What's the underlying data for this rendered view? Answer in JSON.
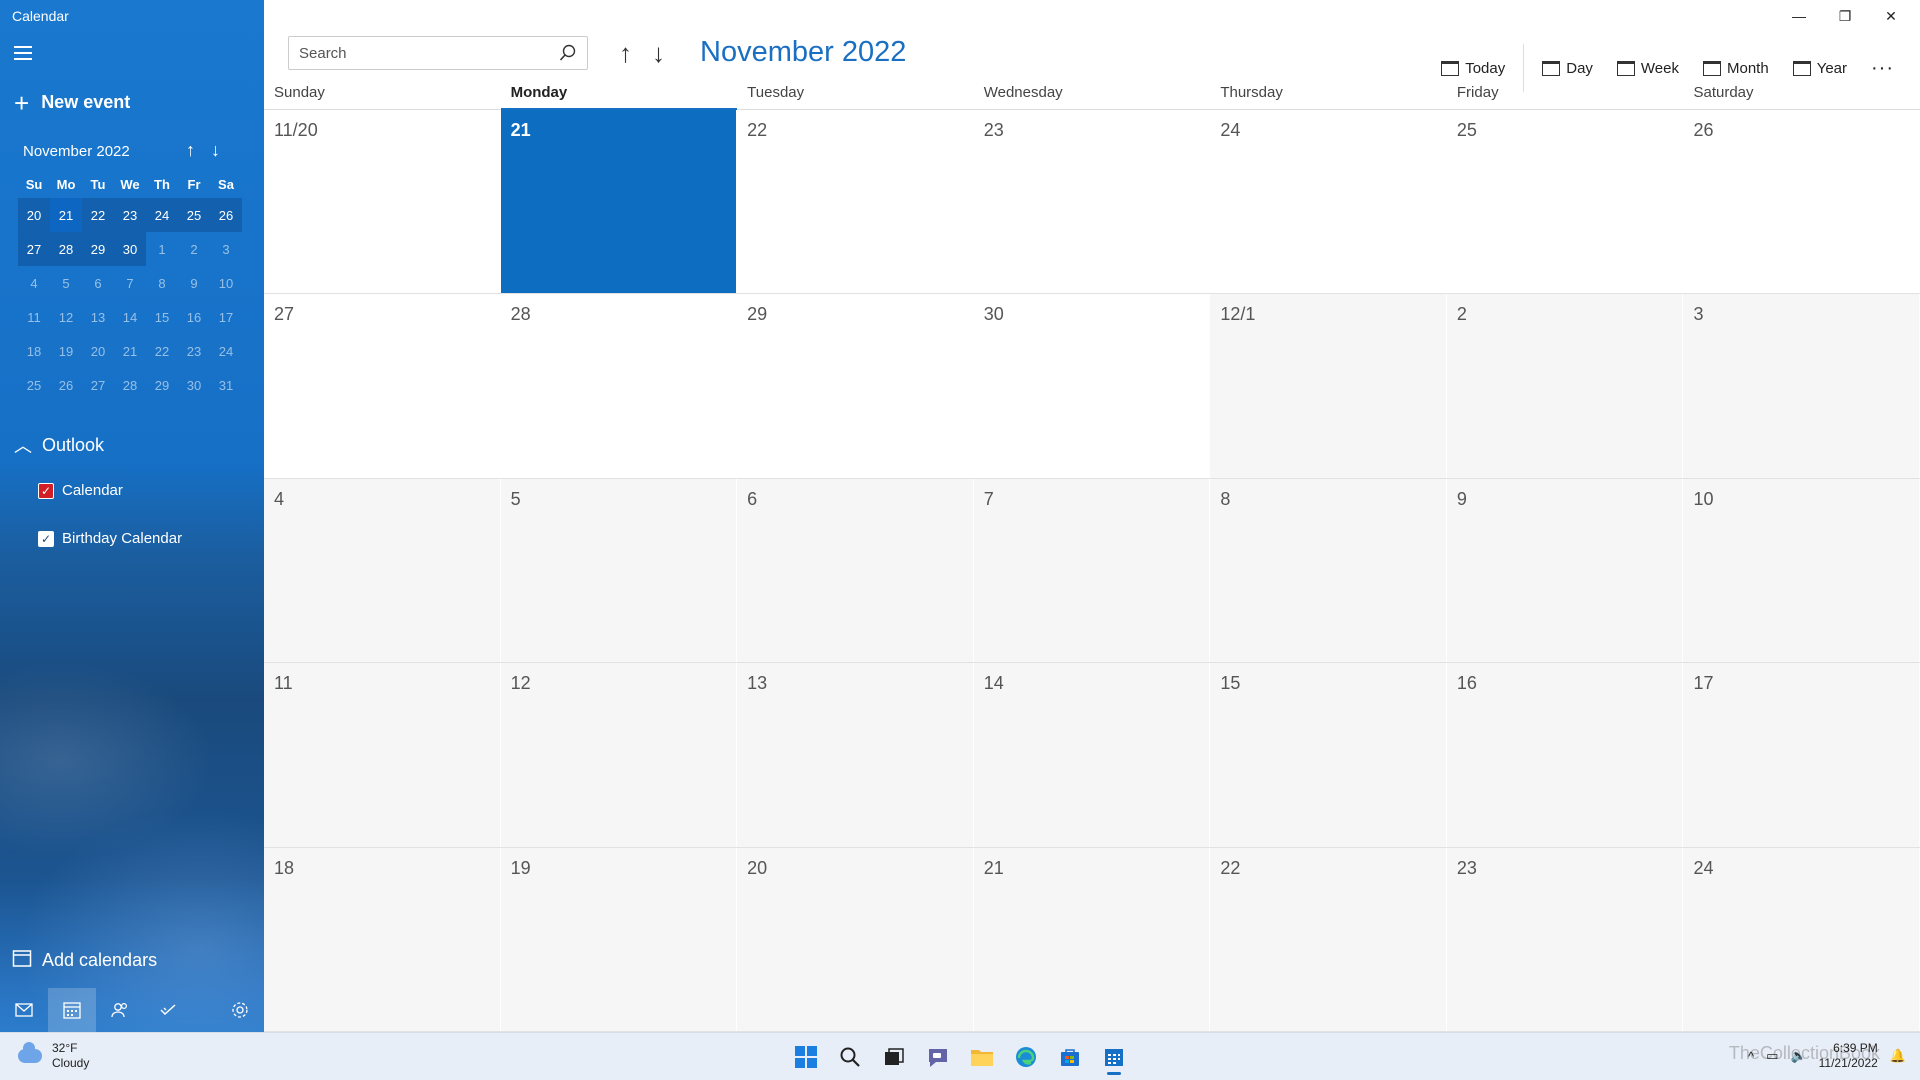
{
  "app": {
    "title": "Calendar"
  },
  "sidebar": {
    "new_event_label": "New event",
    "mini_calendar": {
      "title": "November 2022",
      "day_headers": [
        "Su",
        "Mo",
        "Tu",
        "We",
        "Th",
        "Fr",
        "Sa"
      ],
      "weeks": [
        [
          "20",
          "21",
          "22",
          "23",
          "24",
          "25",
          "26"
        ],
        [
          "27",
          "28",
          "29",
          "30",
          "1",
          "2",
          "3"
        ],
        [
          "4",
          "5",
          "6",
          "7",
          "8",
          "9",
          "10"
        ],
        [
          "11",
          "12",
          "13",
          "14",
          "15",
          "16",
          "17"
        ],
        [
          "18",
          "19",
          "20",
          "21",
          "22",
          "23",
          "24"
        ],
        [
          "25",
          "26",
          "27",
          "28",
          "29",
          "30",
          "31"
        ]
      ]
    },
    "account_label": "Outlook",
    "calendars": [
      {
        "label": "Calendar",
        "color": "#d21f26"
      },
      {
        "label": "Birthday Calendar",
        "color": "#ffffff"
      }
    ],
    "add_calendars_label": "Add calendars",
    "bottom_nav": [
      "mail-icon",
      "calendar-icon",
      "people-icon",
      "todo-icon",
      "settings-icon"
    ]
  },
  "toolbar": {
    "search_placeholder": "Search",
    "month_title": "November 2022",
    "views": {
      "today": "Today",
      "day": "Day",
      "week": "Week",
      "month": "Month",
      "year": "Year"
    },
    "more": "···"
  },
  "calendar": {
    "day_names": [
      "Sunday",
      "Monday",
      "Tuesday",
      "Wednesday",
      "Thursday",
      "Friday",
      "Saturday"
    ],
    "weeks": [
      [
        "11/20",
        "21",
        "22",
        "23",
        "24",
        "25",
        "26"
      ],
      [
        "27",
        "28",
        "29",
        "30",
        "12/1",
        "2",
        "3"
      ],
      [
        "4",
        "5",
        "6",
        "7",
        "8",
        "9",
        "10"
      ],
      [
        "11",
        "12",
        "13",
        "14",
        "15",
        "16",
        "17"
      ],
      [
        "18",
        "19",
        "20",
        "21",
        "22",
        "23",
        "24"
      ]
    ],
    "selected": "21"
  },
  "taskbar": {
    "weather_temp": "32°F",
    "weather_desc": "Cloudy",
    "time": "6:39 PM",
    "date": "11/21/2022",
    "watermark": "TheCollectionBook"
  },
  "colors": {
    "accent": "#1670c6",
    "selected_day": "#0d6dc0"
  }
}
